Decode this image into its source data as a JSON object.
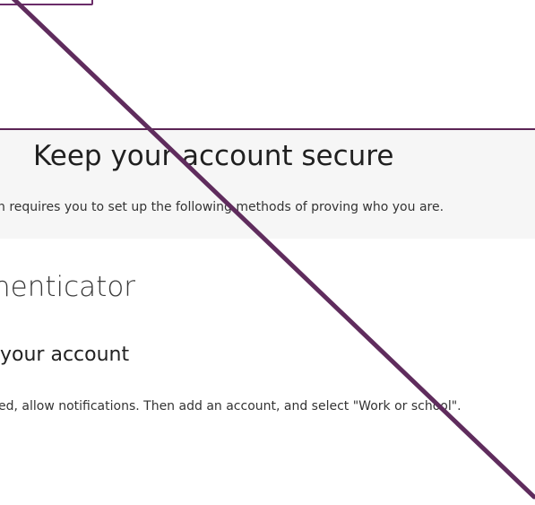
{
  "header": {
    "title": "Keep your account secure",
    "subtitle": "n requires you to set up the following methods of proving who you are."
  },
  "method": {
    "title": "henticator"
  },
  "step": {
    "title": "your account",
    "instruction": "ed, allow notifications. Then add an account, and select \"Work or school\"."
  },
  "colors": {
    "accent": "#6b2d69",
    "header_bg": "#f6f6f6",
    "text": "#202020"
  }
}
